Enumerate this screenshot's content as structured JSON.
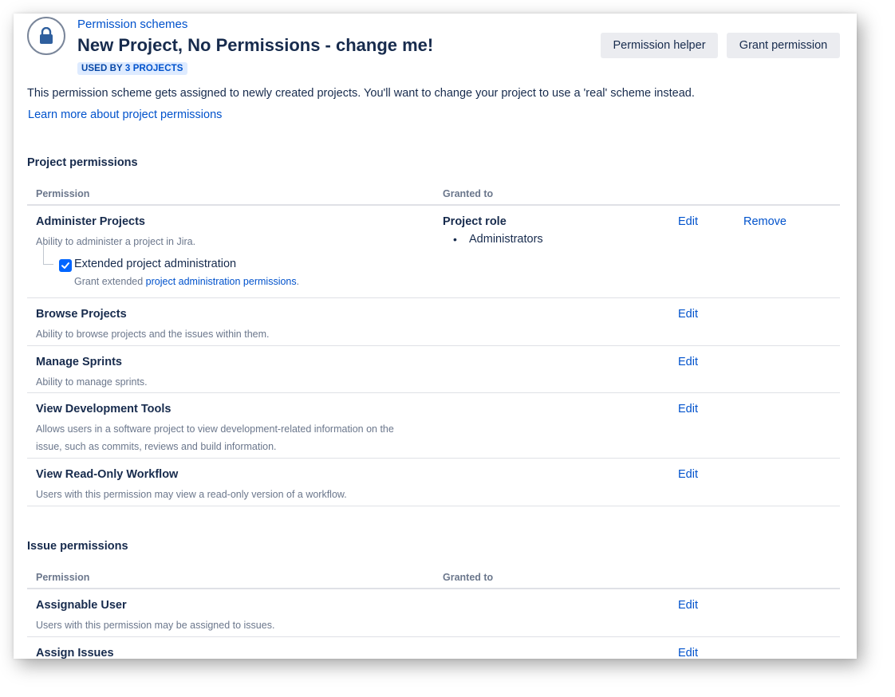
{
  "header": {
    "breadcrumb": "Permission schemes",
    "title": "New Project, No Permissions - change me!",
    "used_by_prefix": "USED BY",
    "used_by_count": "3 PROJECTS",
    "helper_button": "Permission helper",
    "grant_button": "Grant permission",
    "avatar_icon": "lock-icon"
  },
  "description": "This permission scheme gets assigned to newly created projects. You'll want to change your project to use a 'real' scheme instead.",
  "learn_more": "Learn more about project permissions",
  "project_permissions": {
    "title": "Project permissions",
    "col_permission": "Permission",
    "col_granted": "Granted to",
    "rows": [
      {
        "name": "Administer Projects",
        "description": "Ability to administer a project in Jira.",
        "granted_title": "Project role",
        "granted_items": [
          "Administrators"
        ],
        "edit": "Edit",
        "remove": "Remove",
        "extended": {
          "label": "Extended project administration",
          "checked": true,
          "desc_prefix": "Grant extended",
          "desc_link": "project administration permissions",
          "desc_suffix": "."
        }
      },
      {
        "name": "Browse Projects",
        "description": "Ability to browse projects and the issues within them.",
        "edit": "Edit"
      },
      {
        "name": "Manage Sprints",
        "description": "Ability to manage sprints.",
        "edit": "Edit"
      },
      {
        "name": "View Development Tools",
        "description": "Allows users in a software project to view development-related information on the issue, such as commits, reviews and build information.",
        "edit": "Edit"
      },
      {
        "name": "View Read-Only Workflow",
        "description": "Users with this permission may view a read-only version of a workflow.",
        "edit": "Edit"
      }
    ]
  },
  "issue_permissions": {
    "title": "Issue permissions",
    "col_permission": "Permission",
    "col_granted": "Granted to",
    "rows": [
      {
        "name": "Assignable User",
        "description": "Users with this permission may be assigned to issues.",
        "edit": "Edit"
      },
      {
        "name": "Assign Issues",
        "description": "",
        "edit": "Edit"
      }
    ]
  },
  "colors": {
    "link": "#0052cc",
    "text": "#172b4d",
    "muted": "#6b778c",
    "lozenge_bg": "#deebff",
    "checkbox": "#0065ff"
  }
}
